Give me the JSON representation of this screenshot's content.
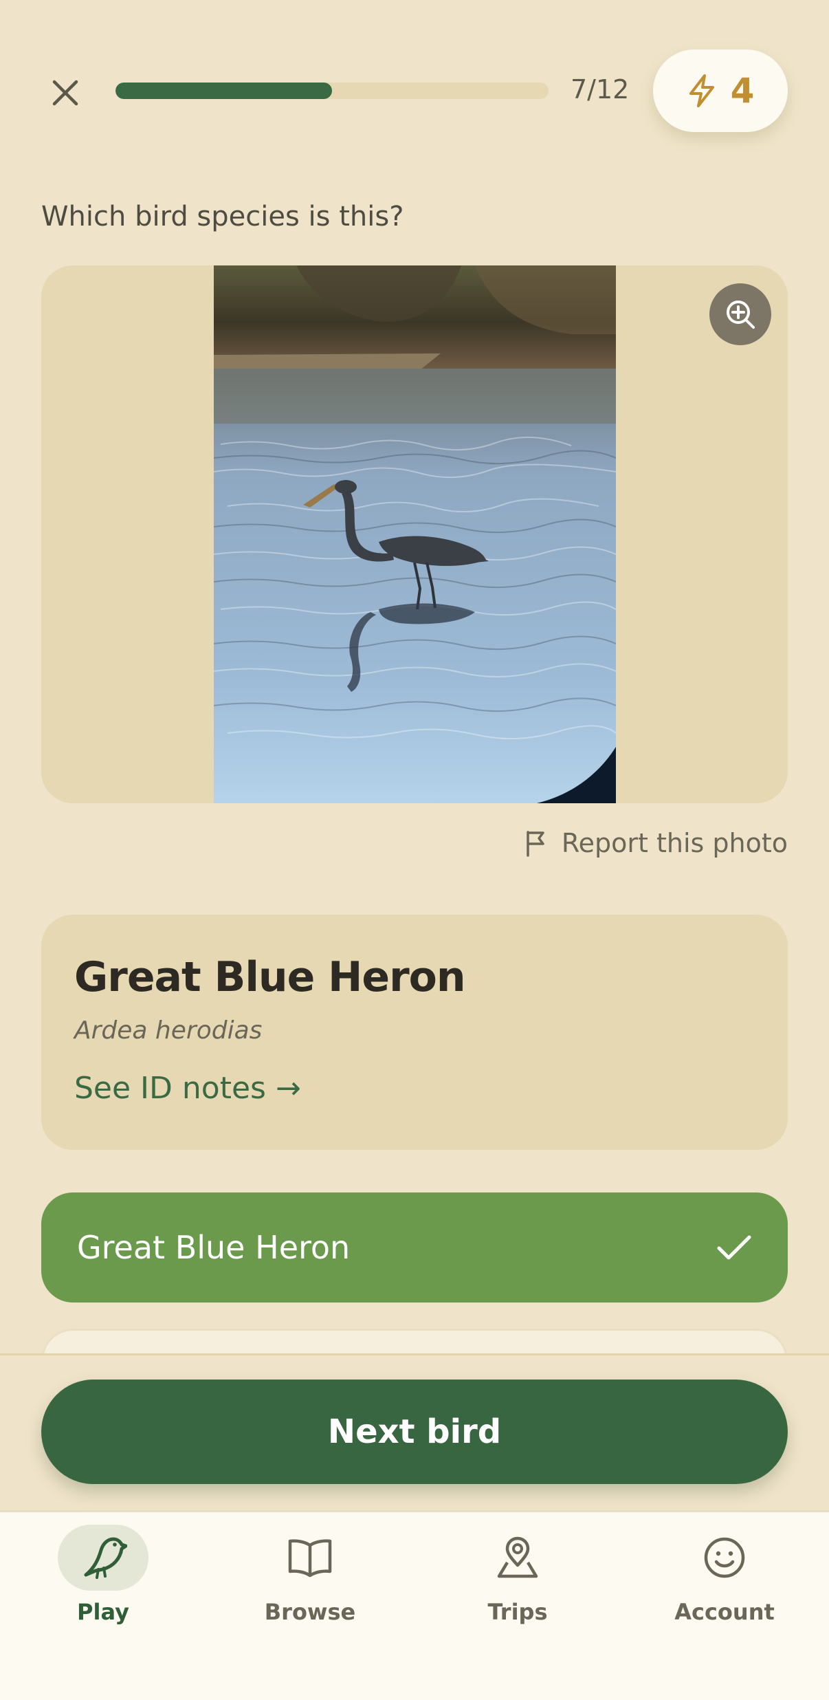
{
  "header": {
    "progress_text": "7/12",
    "progress_fraction": 0.5,
    "streak_count": "4"
  },
  "question": "Which bird species is this?",
  "report_label": "Report this photo",
  "answer": {
    "common_name": "Great Blue Heron",
    "scientific_name": "Ardea herodias",
    "id_notes_link": "See ID notes →"
  },
  "options": [
    {
      "label": "Great Blue Heron",
      "state": "correct"
    }
  ],
  "next_button": "Next bird",
  "tabs": [
    {
      "label": "Play",
      "icon": "bird-icon",
      "active": true
    },
    {
      "label": "Browse",
      "icon": "book-icon",
      "active": false
    },
    {
      "label": "Trips",
      "icon": "map-pin-icon",
      "active": false
    },
    {
      "label": "Account",
      "icon": "smiley-icon",
      "active": false
    }
  ],
  "colors": {
    "background": "#efe4c9",
    "card": "#e6d8b2",
    "primary_green": "#386641",
    "correct_green": "#6b9a4d",
    "streak_gold": "#c18e32"
  }
}
